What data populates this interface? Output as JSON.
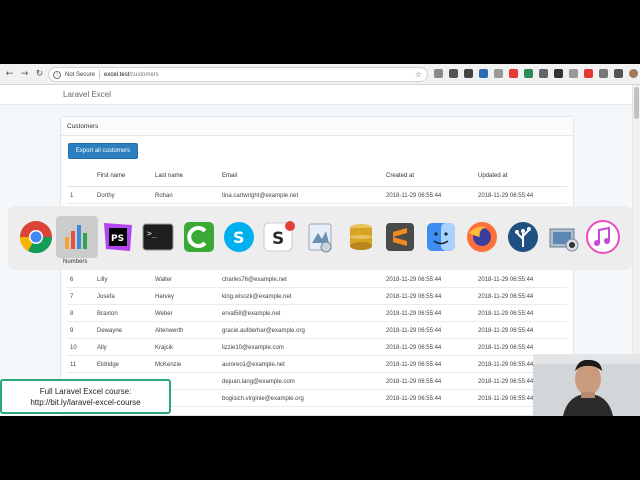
{
  "browser": {
    "not_secure": "Not Secure",
    "url_host": "excel.test",
    "url_path": "/customers"
  },
  "app": {
    "brand": "Laravel Excel"
  },
  "card": {
    "title": "Customers",
    "export_button": "Export all customers"
  },
  "table": {
    "headers": [
      "First name",
      "Last name",
      "Email",
      "Created at",
      "Updated at"
    ],
    "rows": [
      {
        "id": "1",
        "first": "Dorthy",
        "last": "Rohan",
        "email": "tina.cartwright@example.net",
        "created": "2018-11-29 06:55:44",
        "updated": "2018-11-29 06:55:44"
      },
      {
        "id": "6",
        "first": "Lilly",
        "last": "Walter",
        "email": "charles76@example.net",
        "created": "2018-11-29 06:55:44",
        "updated": "2018-11-29 06:55:44"
      },
      {
        "id": "7",
        "first": "Josefa",
        "last": "Harvey",
        "email": "king.wisozk@example.net",
        "created": "2018-11-29 06:55:44",
        "updated": "2018-11-29 06:55:44"
      },
      {
        "id": "8",
        "first": "Braxton",
        "last": "Weber",
        "email": "erval58@example.net",
        "created": "2018-11-29 06:55:44",
        "updated": "2018-11-29 06:55:44"
      },
      {
        "id": "9",
        "first": "Dewayne",
        "last": "Altenwerth",
        "email": "gracie.aufderhar@example.org",
        "created": "2018-11-29 06:55:44",
        "updated": "2018-11-29 06:55:44"
      },
      {
        "id": "10",
        "first": "Ally",
        "last": "Krajcik",
        "email": "lizzie10@example.com",
        "created": "2018-11-29 06:55:44",
        "updated": "2018-11-29 06:55:44"
      },
      {
        "id": "11",
        "first": "Eldridge",
        "last": "McKenzie",
        "email": "auroreo1@example.net",
        "created": "2018-11-29 06:55:44",
        "updated": "2018-11-29 06:55:44"
      },
      {
        "id": "",
        "first": "",
        "last": "",
        "email": "dejuan.lang@example.com",
        "created": "2018-11-29 06:55:44",
        "updated": "2018-11-29 06:55:44"
      },
      {
        "id": "",
        "first": "",
        "last": "al",
        "email": "bogisich.virginie@example.org",
        "created": "2018-11-29 06:55:44",
        "updated": "2018-11-29 06:55:44"
      }
    ]
  },
  "dock": {
    "hovered_label": "Numbers",
    "apps": [
      {
        "icon": "chrome-icon",
        "color": "#dd4b39"
      },
      {
        "icon": "numbers-icon",
        "color": "#2ea44f"
      },
      {
        "icon": "phpstorm-icon",
        "color": "#b345f1"
      },
      {
        "icon": "terminal-icon",
        "color": "#222222"
      },
      {
        "icon": "camtasia-icon",
        "color": "#3aa935"
      },
      {
        "icon": "skype-icon",
        "color": "#00aff0"
      },
      {
        "icon": "slack-icon",
        "color": "#e01e5a"
      },
      {
        "icon": "preview-icon",
        "color": "#6b8fb3"
      },
      {
        "icon": "sequel-pro-icon",
        "color": "#d9a323"
      },
      {
        "icon": "sublime-text-icon",
        "color": "#f28a1e"
      },
      {
        "icon": "finder-icon",
        "color": "#3d8ef0"
      },
      {
        "icon": "firefox-icon",
        "color": "#ff7139"
      },
      {
        "icon": "sourcetree-icon",
        "color": "#205081"
      },
      {
        "icon": "image-capture-icon",
        "color": "#7a8a99"
      },
      {
        "icon": "itunes-icon",
        "color": "#ea4cc0"
      }
    ]
  },
  "promo": {
    "line1": "Full Laravel Excel course:",
    "line2": "http://bit.ly/laravel-excel-course"
  }
}
